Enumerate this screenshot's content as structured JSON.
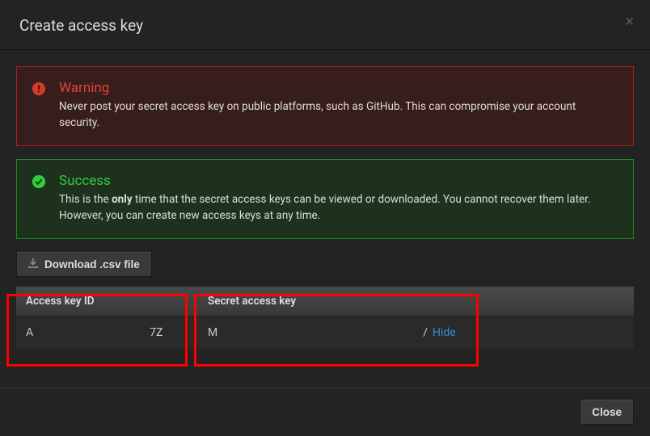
{
  "header": {
    "title": "Create access key",
    "close": "×"
  },
  "alerts": {
    "warning": {
      "title": "Warning",
      "text": "Never post your secret access key on public platforms, such as GitHub. This can compromise your account security."
    },
    "success": {
      "title": "Success",
      "text_pre": "This is the ",
      "text_bold": "only",
      "text_post": " time that the secret access keys can be viewed or downloaded. You cannot recover them later. However, you can create new access keys at any time."
    }
  },
  "download": {
    "label": "Download .csv file"
  },
  "table": {
    "col_id": "Access key ID",
    "col_secret": "Secret access key",
    "id_prefix": "A",
    "id_suffix": "7Z",
    "secret_prefix": "M",
    "secret_suffix": "/",
    "hide": "Hide"
  },
  "footer": {
    "close": "Close"
  }
}
